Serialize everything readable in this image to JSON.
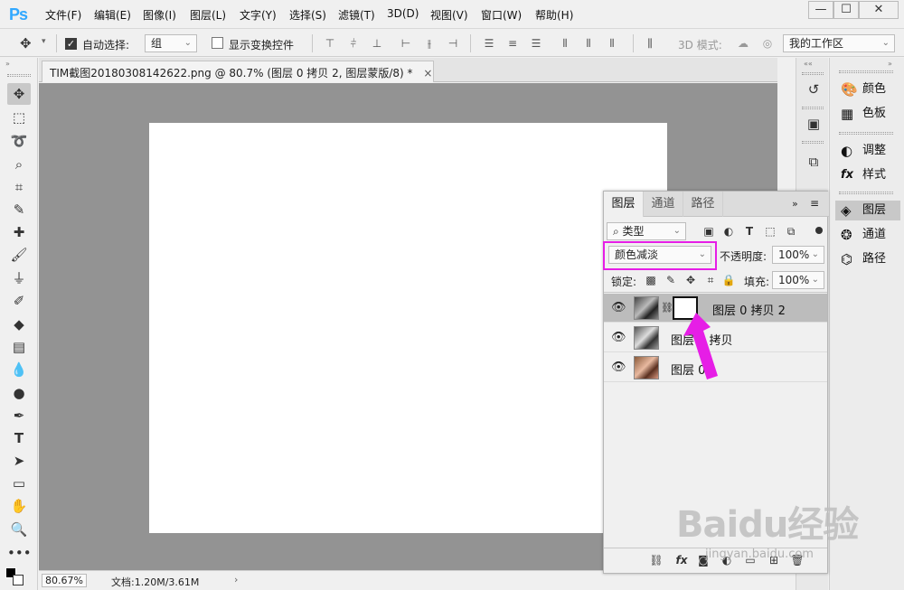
{
  "app": {
    "logo": "Ps"
  },
  "menu": [
    "文件(F)",
    "编辑(E)",
    "图像(I)",
    "图层(L)",
    "文字(Y)",
    "选择(S)",
    "滤镜(T)",
    "3D(D)",
    "视图(V)",
    "窗口(W)",
    "帮助(H)"
  ],
  "window_controls": {
    "minimize": "—",
    "maximize": "☐",
    "close": "✕"
  },
  "options": {
    "auto_select_label": "自动选择:",
    "auto_select_checked": true,
    "auto_select_value": "组",
    "show_transform_label": "显示变换控件",
    "show_transform_checked": false,
    "mode_3d_label": "3D 模式:",
    "workspace": "我的工作区"
  },
  "document": {
    "tab_title": "TIM截图20180308142622.png @ 80.7% (图层 0 拷贝 2, 图层蒙版/8) *",
    "tab_close": "×",
    "zoom": "80.67%",
    "doc_info": "文档:1.20M/3.61M",
    "status_arrow": "›"
  },
  "right_panels": [
    {
      "icon": "palette-icon",
      "glyph": "🎨",
      "label": "颜色"
    },
    {
      "icon": "swatches-icon",
      "glyph": "▦",
      "label": "色板"
    },
    {
      "icon": "adjustments-icon",
      "glyph": "◐",
      "label": "调整"
    },
    {
      "icon": "styles-icon",
      "glyph": "fx",
      "label": "样式"
    },
    {
      "icon": "layers-icon",
      "glyph": "◈",
      "label": "图层"
    },
    {
      "icon": "channels-icon",
      "glyph": "❂",
      "label": "通道"
    },
    {
      "icon": "paths-icon",
      "glyph": "⌬",
      "label": "路径"
    }
  ],
  "layers_panel": {
    "tabs": [
      "图层",
      "通道",
      "路径"
    ],
    "filter_kind": "类型",
    "blend_mode": "颜色减淡",
    "opacity_label": "不透明度:",
    "opacity_value": "100%",
    "lock_label": "锁定:",
    "fill_label": "填充:",
    "fill_value": "100%",
    "layers": [
      {
        "name": "图层 0 拷贝 2",
        "visible": true,
        "selected": true,
        "has_mask": true
      },
      {
        "name": "图层 0 拷贝",
        "visible": true,
        "selected": false,
        "has_mask": false
      },
      {
        "name": "图层 0",
        "visible": true,
        "selected": false,
        "has_mask": false
      }
    ],
    "footer_icons": [
      "link-icon",
      "fx-icon",
      "mask-icon",
      "adjustment-icon",
      "group-icon",
      "new-layer-icon",
      "delete-icon"
    ]
  },
  "watermark": {
    "text": "Baidu经验",
    "sub": "jingyan.baidu.com"
  },
  "colors": {
    "highlight": "#e61ee6",
    "arrow": "#e61ee6",
    "canvas_bg": "#939393"
  }
}
